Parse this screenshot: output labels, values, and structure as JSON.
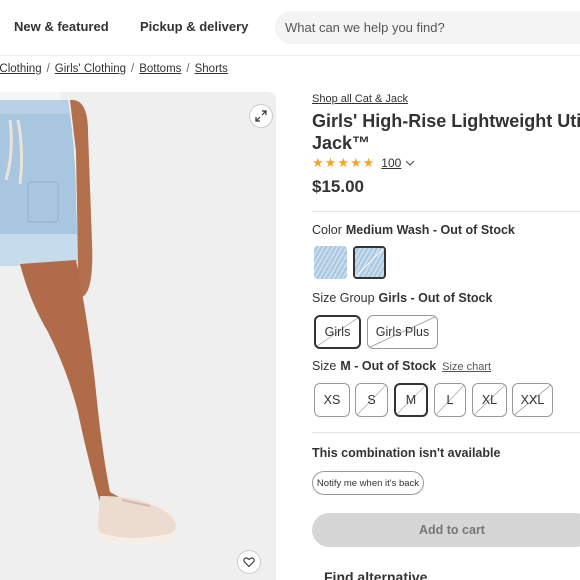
{
  "nav": {
    "new_featured": "New & featured",
    "pickup_delivery": "Pickup & delivery",
    "search_placeholder": "What can we help you find?"
  },
  "breadcrumb": [
    "' Clothing",
    "Girls' Clothing",
    "Bottoms",
    "Shorts"
  ],
  "product": {
    "shop_link": "Shop all Cat & Jack",
    "title_line1": "Girls' High-Rise Lightweight Utility",
    "title_line2": "Jack™",
    "rating_stars": 5,
    "rating_count": "100",
    "price": "$15.00"
  },
  "color": {
    "label": "Color",
    "value": "Medium Wash - Out of Stock",
    "swatches": [
      {
        "name": "light-wash",
        "selected": false
      },
      {
        "name": "medium-wash",
        "selected": true,
        "out_of_stock": true
      }
    ]
  },
  "size_group": {
    "label": "Size Group",
    "value": "Girls - Out of Stock",
    "options": [
      {
        "label": "Girls",
        "selected": true,
        "out_of_stock": true
      },
      {
        "label": "Girls Plus",
        "selected": false,
        "out_of_stock": true
      }
    ]
  },
  "size": {
    "label": "Size",
    "value": "M - Out of Stock",
    "size_chart": "Size chart",
    "options": [
      {
        "label": "XS",
        "selected": false,
        "out_of_stock": false
      },
      {
        "label": "S",
        "selected": false,
        "out_of_stock": true
      },
      {
        "label": "M",
        "selected": true,
        "out_of_stock": true
      },
      {
        "label": "L",
        "selected": false,
        "out_of_stock": true
      },
      {
        "label": "XL",
        "selected": false,
        "out_of_stock": true
      },
      {
        "label": "XXL",
        "selected": false,
        "out_of_stock": true
      }
    ]
  },
  "availability": {
    "message": "This combination isn't available",
    "notify_label": "Notify me when it's back"
  },
  "cart": {
    "add_label": "Add to cart",
    "find_alt_label": "Find alternative"
  },
  "colors": {
    "star": "#f5a623",
    "disabled_button": "#d6d6d6",
    "swatch_denim": "#b9d3e6"
  }
}
